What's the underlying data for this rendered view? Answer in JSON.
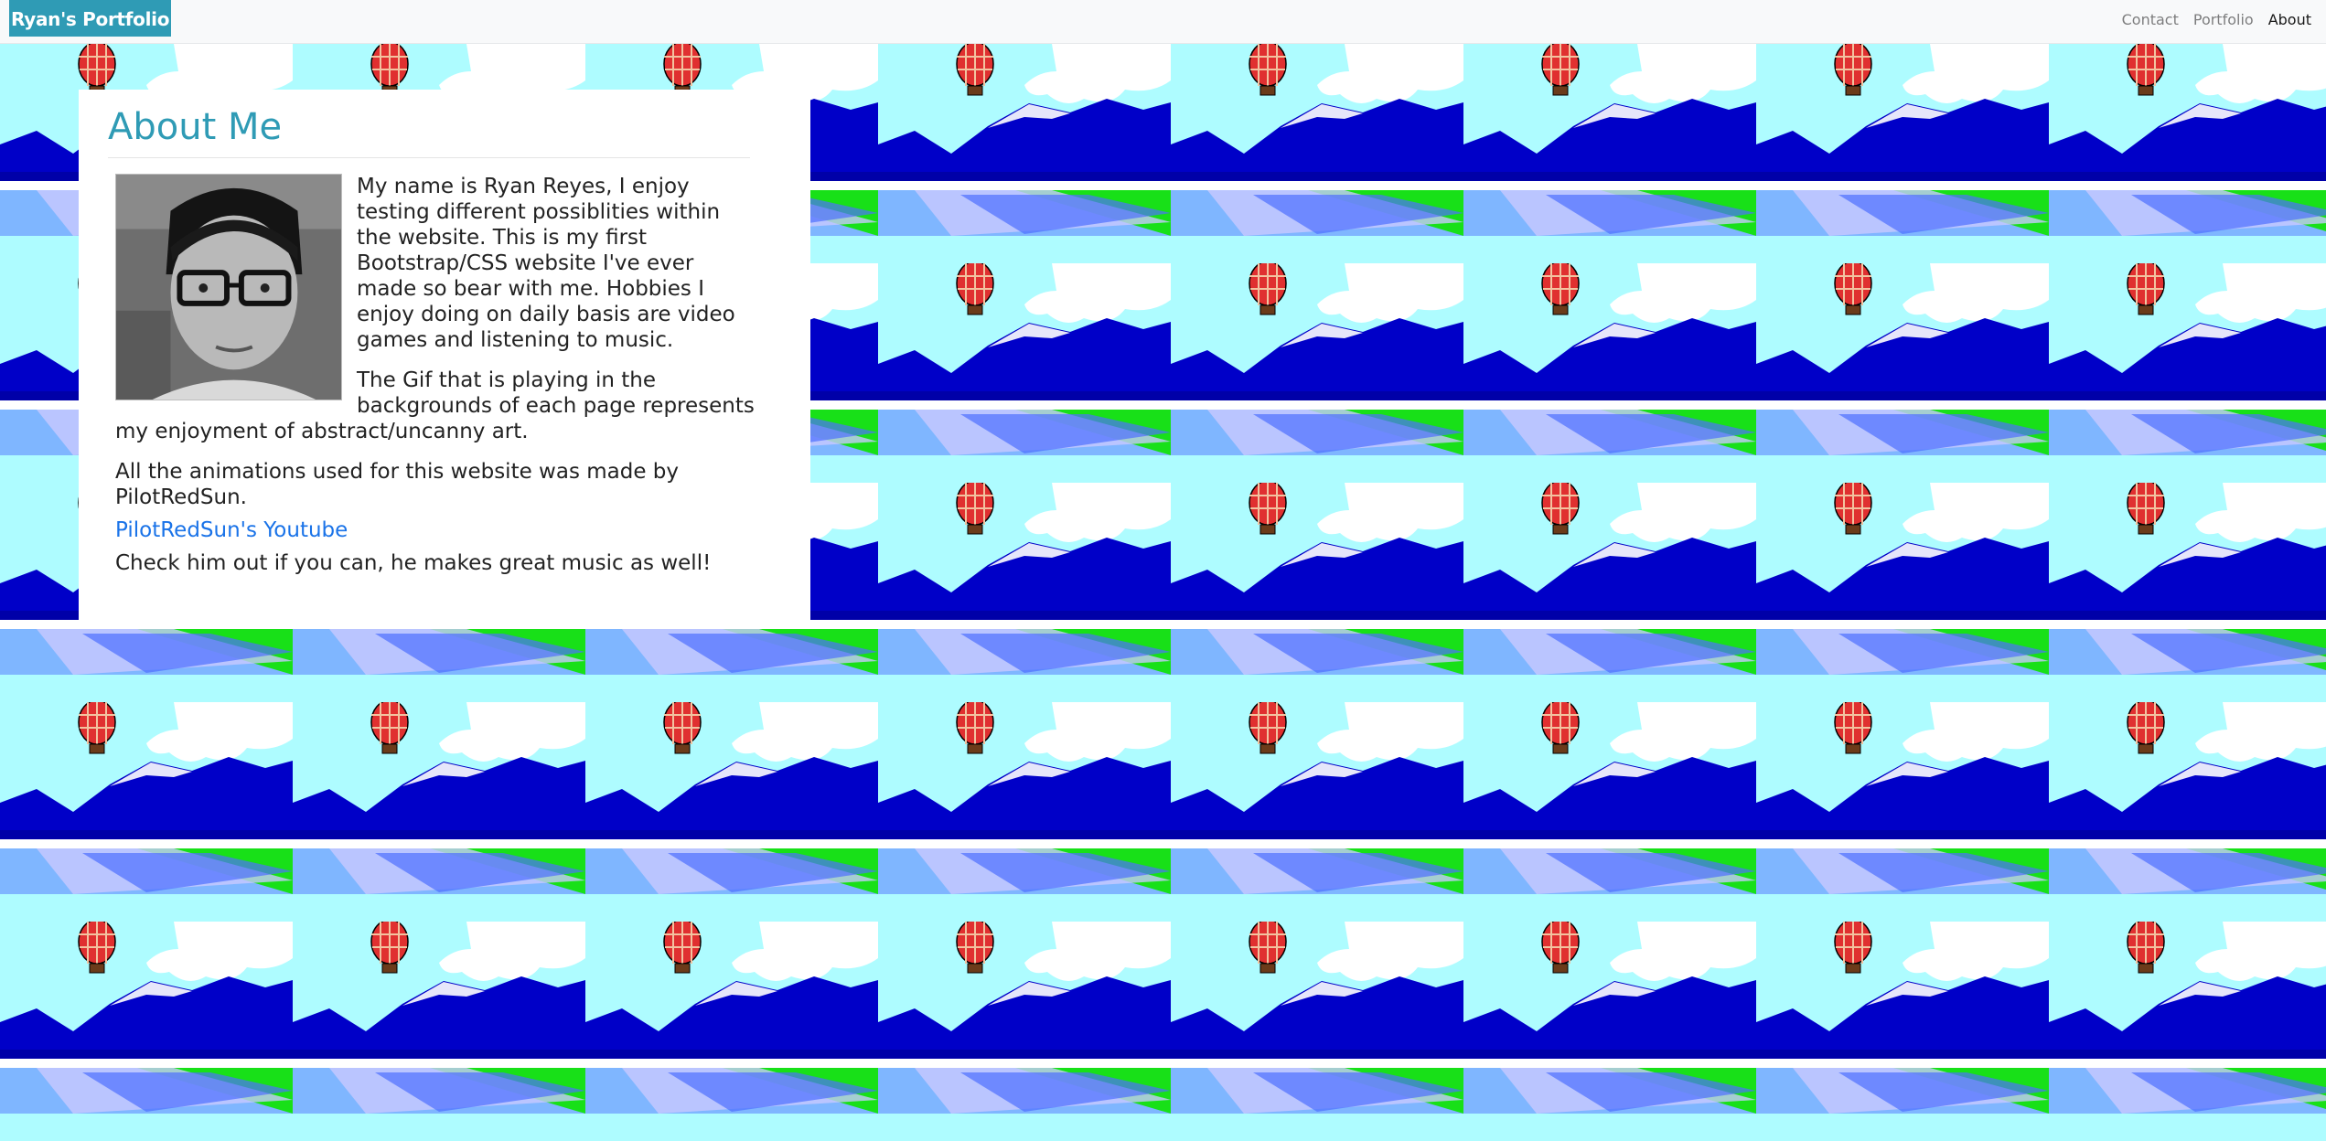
{
  "navbar": {
    "brand": "Ryan's Portfolio",
    "links": [
      {
        "label": "Contact",
        "active": false
      },
      {
        "label": "Portfolio",
        "active": false
      },
      {
        "label": "About",
        "active": true
      }
    ]
  },
  "about": {
    "heading": "About Me",
    "paragraphs": [
      "My name is Ryan Reyes, I enjoy testing different possiblities within the website. This is my first Bootstrap/CSS website I've ever made so bear with me. Hobbies I enjoy doing on daily basis are video games and listening to music.",
      "The Gif that is playing in the backgrounds of each page represents my enjoyment of abstract/uncanny art.",
      "All the animations used for this website was made by PilotRedSun."
    ],
    "link_label": "PilotRedSun's Youtube",
    "closing": "Check him out if you can, he makes great music as well!"
  },
  "colors": {
    "accent": "#2f9bb5",
    "link": "#1a73e8",
    "sky": "#aefcff",
    "mountain": "#0000c8",
    "grass": "#18e018"
  },
  "icons": {
    "avatar": "profile-photo",
    "background": "hot-air-balloon-landscape"
  }
}
